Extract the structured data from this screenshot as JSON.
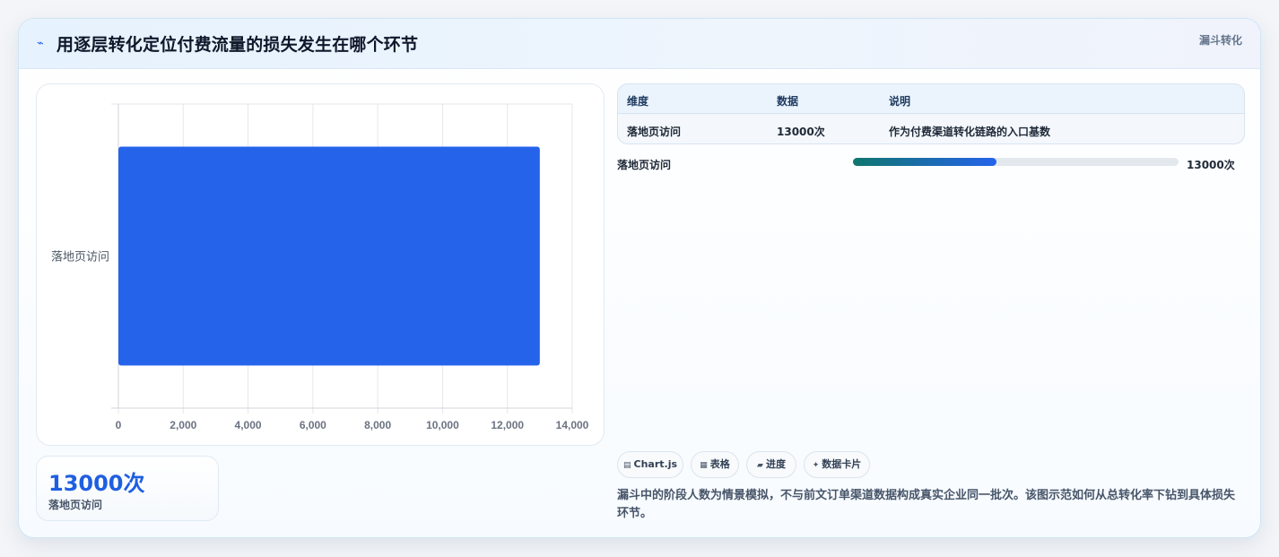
{
  "header": {
    "icon": "trend-line-icon",
    "title": "用逐层转化定位付费流量的损失发生在哪个环节",
    "tag": "漏斗转化"
  },
  "chart_data": {
    "type": "bar",
    "orientation": "horizontal",
    "categories": [
      "落地页访问"
    ],
    "values": [
      13000
    ],
    "xlim": [
      0,
      14000
    ],
    "x_ticks": [
      "0",
      "2,000",
      "4,000",
      "6,000",
      "8,000",
      "10,000",
      "12,000",
      "14,000"
    ],
    "bar_color": "#2563eb",
    "grid": true
  },
  "stat": {
    "value": "13000次",
    "label": "落地页访问"
  },
  "table": {
    "headers": [
      "维度",
      "数据",
      "说明"
    ],
    "rows": [
      [
        "落地页访问",
        "13000次",
        "作为付费渠道转化链路的入口基数"
      ]
    ]
  },
  "progress": {
    "label": "落地页访问",
    "value_text": "13000次",
    "fraction": 0.44
  },
  "chips": [
    {
      "icon": "chart-icon",
      "glyph": "▤",
      "label": "Chart.js"
    },
    {
      "icon": "table-icon",
      "glyph": "▦",
      "label": "表格"
    },
    {
      "icon": "progress-icon",
      "glyph": "▰",
      "label": "进度"
    },
    {
      "icon": "sparkle-icon",
      "glyph": "✦",
      "label": "数据卡片"
    }
  ],
  "note": "漏斗中的阶段人数为情景模拟，不与前文订单渠道数据构成真实企业同一批次。该图示范如何从总转化率下钻到具体损失环节。"
}
